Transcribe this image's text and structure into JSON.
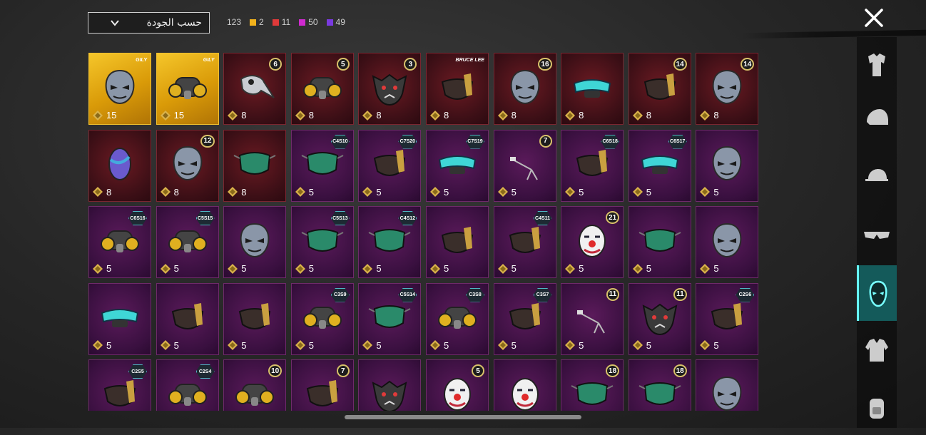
{
  "toolbar": {
    "sort_label": "حسب الجودة",
    "total_count": "123",
    "rarity_counts": [
      {
        "value": "2",
        "color": "#f2b21c"
      },
      {
        "value": "11",
        "color": "#e03a3a"
      },
      {
        "value": "50",
        "color": "#d02ad0"
      },
      {
        "value": "49",
        "color": "#7a3ae0"
      }
    ]
  },
  "side_tabs": [
    "outfit-icon",
    "helmet-icon",
    "cap-icon",
    "glasses-icon",
    "mask-icon",
    "jacket-icon",
    "backpack-icon"
  ],
  "active_tab": "mask-icon",
  "items": [
    {
      "rarity": "gold",
      "qty": "15",
      "badge": "GILY",
      "badge_type": "brand",
      "art": "mask"
    },
    {
      "rarity": "gold",
      "qty": "15",
      "badge": "GILY",
      "badge_type": "brand",
      "art": "respirator"
    },
    {
      "rarity": "red",
      "qty": "8",
      "badge": "6",
      "badge_type": "num",
      "art": "plague"
    },
    {
      "rarity": "red",
      "qty": "8",
      "badge": "5",
      "badge_type": "num",
      "art": "respirator"
    },
    {
      "rarity": "red",
      "qty": "8",
      "badge": "3",
      "badge_type": "num",
      "art": "beast"
    },
    {
      "rarity": "red",
      "qty": "8",
      "badge": "BRUCE LEE",
      "badge_type": "brand",
      "art": "halfmask"
    },
    {
      "rarity": "red",
      "qty": "8",
      "badge": "16",
      "badge_type": "num",
      "art": "mask"
    },
    {
      "rarity": "red",
      "qty": "8",
      "badge": "",
      "badge_type": "none",
      "art": "visor"
    },
    {
      "rarity": "red",
      "qty": "8",
      "badge": "14",
      "badge_type": "num",
      "art": "halfmask"
    },
    {
      "rarity": "red",
      "qty": "8",
      "badge": "14",
      "badge_type": "num",
      "art": "mask"
    },
    {
      "rarity": "red",
      "qty": "8",
      "badge": "",
      "badge_type": "none",
      "art": "egg"
    },
    {
      "rarity": "red",
      "qty": "8",
      "badge": "12",
      "badge_type": "num",
      "art": "mask"
    },
    {
      "rarity": "red",
      "qty": "8",
      "badge": "",
      "badge_type": "none",
      "art": "cloth"
    },
    {
      "rarity": "purple",
      "qty": "5",
      "badge": "C4S10",
      "badge_type": "cs",
      "art": "cloth"
    },
    {
      "rarity": "purple",
      "qty": "5",
      "badge": "C7S20",
      "badge_type": "cs",
      "art": "halfmask"
    },
    {
      "rarity": "purple",
      "qty": "5",
      "badge": "C7S19",
      "badge_type": "cs",
      "art": "visor"
    },
    {
      "rarity": "purple",
      "qty": "5",
      "badge": "7",
      "badge_type": "num",
      "art": "small"
    },
    {
      "rarity": "purple",
      "qty": "5",
      "badge": "C6S18",
      "badge_type": "cs",
      "art": "halfmask"
    },
    {
      "rarity": "purple",
      "qty": "5",
      "badge": "C6S17",
      "badge_type": "cs",
      "art": "visor"
    },
    {
      "rarity": "purple",
      "qty": "5",
      "badge": "",
      "badge_type": "none",
      "art": "mask"
    },
    {
      "rarity": "purple",
      "qty": "5",
      "badge": "C6S16",
      "badge_type": "cs",
      "art": "respirator"
    },
    {
      "rarity": "purple",
      "qty": "5",
      "badge": "C5S15",
      "badge_type": "cs",
      "art": "respirator"
    },
    {
      "rarity": "purple",
      "qty": "5",
      "badge": "",
      "badge_type": "none",
      "art": "mask"
    },
    {
      "rarity": "purple",
      "qty": "5",
      "badge": "C5S13",
      "badge_type": "cs",
      "art": "cloth"
    },
    {
      "rarity": "purple",
      "qty": "5",
      "badge": "C4S12",
      "badge_type": "cs",
      "art": "cloth"
    },
    {
      "rarity": "purple",
      "qty": "5",
      "badge": "",
      "badge_type": "none",
      "art": "halfmask"
    },
    {
      "rarity": "purple",
      "qty": "5",
      "badge": "C4S11",
      "badge_type": "cs",
      "art": "halfmask"
    },
    {
      "rarity": "purple",
      "qty": "5",
      "badge": "21",
      "badge_type": "num",
      "art": "clown"
    },
    {
      "rarity": "purple",
      "qty": "5",
      "badge": "",
      "badge_type": "none",
      "art": "cloth"
    },
    {
      "rarity": "purple",
      "qty": "5",
      "badge": "",
      "badge_type": "none",
      "art": "mask"
    },
    {
      "rarity": "purple",
      "qty": "5",
      "badge": "",
      "badge_type": "none",
      "art": "visor"
    },
    {
      "rarity": "purple",
      "qty": "5",
      "badge": "",
      "badge_type": "none",
      "art": "halfmask"
    },
    {
      "rarity": "purple",
      "qty": "5",
      "badge": "",
      "badge_type": "none",
      "art": "halfmask"
    },
    {
      "rarity": "purple",
      "qty": "5",
      "badge": "C3S9",
      "badge_type": "cs",
      "art": "respirator"
    },
    {
      "rarity": "purple",
      "qty": "5",
      "badge": "C5S14",
      "badge_type": "cs",
      "art": "cloth"
    },
    {
      "rarity": "purple",
      "qty": "5",
      "badge": "C3S8",
      "badge_type": "cs",
      "art": "respirator"
    },
    {
      "rarity": "purple",
      "qty": "5",
      "badge": "C3S7",
      "badge_type": "cs",
      "art": "halfmask"
    },
    {
      "rarity": "purple",
      "qty": "5",
      "badge": "11",
      "badge_type": "num",
      "art": "small"
    },
    {
      "rarity": "purple",
      "qty": "5",
      "badge": "11",
      "badge_type": "num",
      "art": "beast"
    },
    {
      "rarity": "purple",
      "qty": "5",
      "badge": "C2S6",
      "badge_type": "cs",
      "art": "halfmask"
    },
    {
      "rarity": "purple",
      "qty": "",
      "badge": "C2S5",
      "badge_type": "cs",
      "art": "halfmask"
    },
    {
      "rarity": "purple",
      "qty": "",
      "badge": "C2S4",
      "badge_type": "cs",
      "art": "respirator"
    },
    {
      "rarity": "purple",
      "qty": "",
      "badge": "10",
      "badge_type": "num",
      "art": "respirator"
    },
    {
      "rarity": "purple",
      "qty": "",
      "badge": "7",
      "badge_type": "num",
      "art": "halfmask"
    },
    {
      "rarity": "purple",
      "qty": "",
      "badge": "",
      "badge_type": "none",
      "art": "beast"
    },
    {
      "rarity": "purple",
      "qty": "",
      "badge": "5",
      "badge_type": "num",
      "art": "clown"
    },
    {
      "rarity": "purple",
      "qty": "",
      "badge": "",
      "badge_type": "none",
      "art": "clown"
    },
    {
      "rarity": "purple",
      "qty": "",
      "badge": "18",
      "badge_type": "num",
      "art": "cloth"
    },
    {
      "rarity": "purple",
      "qty": "",
      "badge": "18",
      "badge_type": "num",
      "art": "cloth"
    },
    {
      "rarity": "purple",
      "qty": "",
      "badge": "",
      "badge_type": "none",
      "art": "mask"
    }
  ]
}
